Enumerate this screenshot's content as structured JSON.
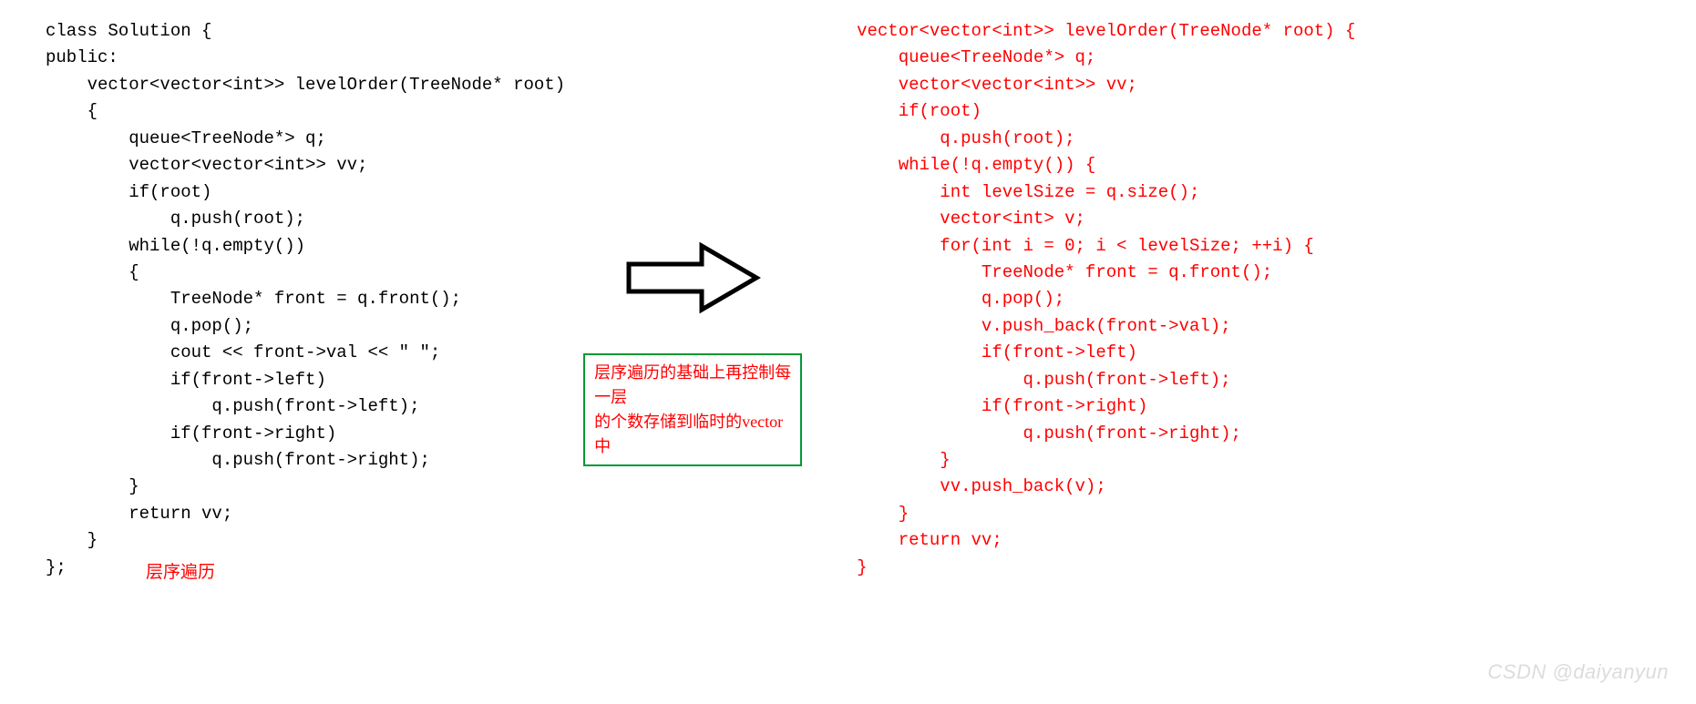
{
  "left": {
    "code": "class Solution {\npublic:\n    vector<vector<int>> levelOrder(TreeNode* root)\n    {\n        queue<TreeNode*> q;\n        vector<vector<int>> vv;\n        if(root)\n            q.push(root);\n        while(!q.empty())\n        {\n            TreeNode* front = q.front();\n            q.pop();\n            cout << front->val << \" \";\n            if(front->left)\n                q.push(front->left);\n            if(front->right)\n                q.push(front->right);\n        }\n        return vv;\n    }\n};",
    "label": "层序遍历"
  },
  "mid": {
    "note_line1": "层序遍历的基础上再控制每一层",
    "note_line2": "的个数存储到临时的vector中"
  },
  "right": {
    "code": "vector<vector<int>> levelOrder(TreeNode* root) {\n    queue<TreeNode*> q;\n    vector<vector<int>> vv;\n    if(root)\n        q.push(root);\n    while(!q.empty()) {\n        int levelSize = q.size();\n        vector<int> v;\n        for(int i = 0; i < levelSize; ++i) {\n            TreeNode* front = q.front();\n            q.pop();\n            v.push_back(front->val);\n            if(front->left)\n                q.push(front->left);\n            if(front->right)\n                q.push(front->right);\n        }\n        vv.push_back(v);\n    }\n    return vv;\n}"
  },
  "watermark": "CSDN @daiyanyun"
}
